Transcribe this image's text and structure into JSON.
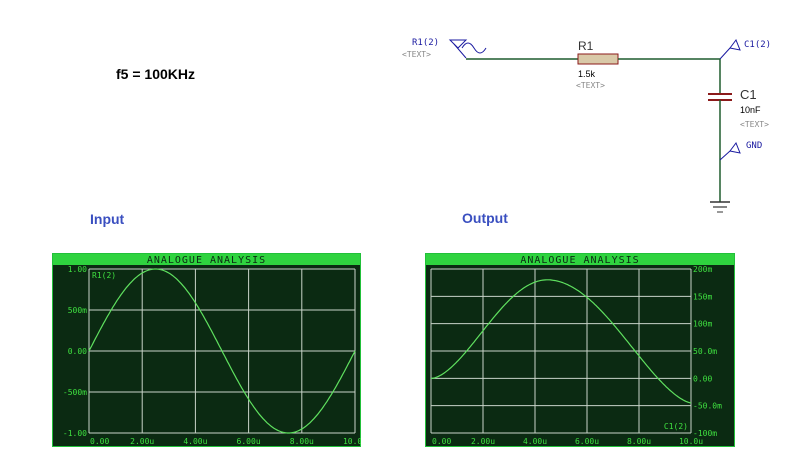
{
  "frequency_label": "f5 = 100KHz",
  "schematic": {
    "source_label": "R1(2)",
    "source_text": "<TEXT>",
    "resistor_name": "R1",
    "resistor_value": "1.5k",
    "resistor_text": "<TEXT>",
    "probe_label": "C1(2)",
    "capacitor_name": "C1",
    "capacitor_value": "10nF",
    "capacitor_text": "<TEXT>",
    "ground_label": "GND",
    "colors": {
      "wire": "#1f5c2e",
      "resistor_fill": "#d9c9a8",
      "resistor_stroke": "#8b1a1a",
      "capacitor": "#8b1a1a",
      "probe": "#1a1aa0"
    }
  },
  "input_section_label": "Input",
  "output_section_label": "Output",
  "graphs": [
    {
      "title": "ANALOGUE ANALYSIS",
      "trace_label": "R1(2)",
      "y_ticks": [
        "1.00",
        "500m",
        "0.00",
        "-500m",
        "-1.00"
      ],
      "x_ticks": [
        "0.00",
        "2.00u",
        "4.00u",
        "6.00u",
        "8.00u",
        "10.0u"
      ],
      "axis_side": "left",
      "chart_data": {
        "type": "line",
        "x_range": [
          0,
          10
        ],
        "x_unit": "u",
        "ylim": [
          -1,
          1
        ],
        "function": "sine",
        "amplitude": 1,
        "period": 10,
        "phase": 0
      }
    },
    {
      "title": "ANALOGUE ANALYSIS",
      "trace_label": "C1(2)",
      "y_ticks": [
        "200m",
        "150m",
        "100m",
        "50.0m",
        "0.00",
        "-50.0m",
        "-100m"
      ],
      "x_ticks": [
        "0.00",
        "2.00u",
        "4.00u",
        "6.00u",
        "8.00u",
        "10.0u"
      ],
      "axis_side": "right",
      "chart_data": {
        "type": "line",
        "x_range": [
          0,
          10
        ],
        "x_unit": "u",
        "ylim": [
          -100,
          200
        ],
        "y_unit": "m",
        "function": "rc_response",
        "peak": 180,
        "peak_x": 4.6,
        "start": 0,
        "end": -45
      }
    }
  ],
  "colors": {
    "graph_bg": "#0b2a12",
    "graph_border": "#22c03a",
    "title_bar": "#2fd33f",
    "grid": "#c9d4c9",
    "trace": "#5fe05f",
    "tick_text": "#3fe040"
  }
}
